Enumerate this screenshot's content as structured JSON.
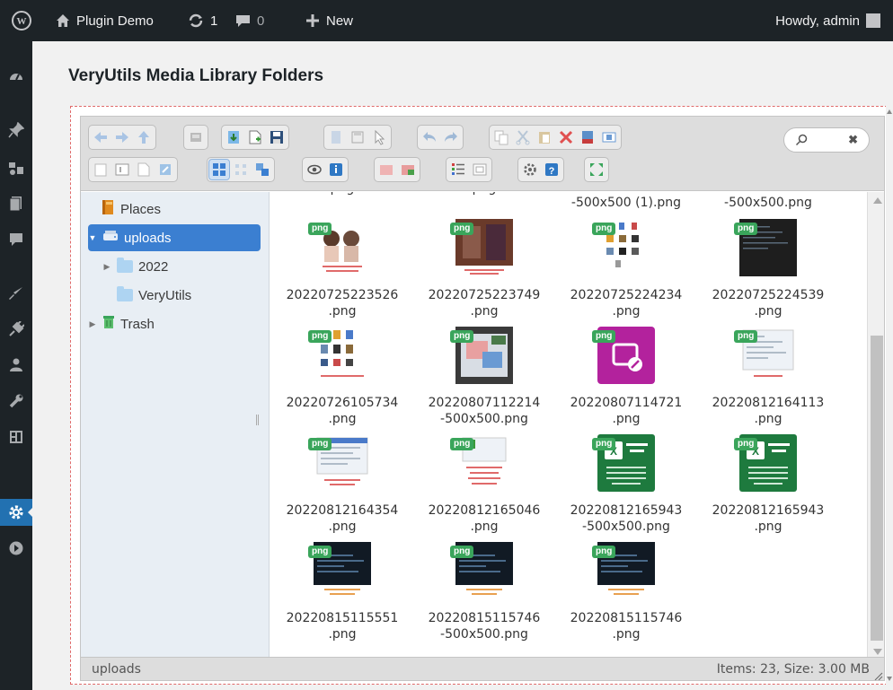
{
  "adminbar": {
    "site_name": "Plugin Demo",
    "updates_count": "1",
    "comments_count": "0",
    "new_label": "New",
    "howdy": "Howdy, admin"
  },
  "page": {
    "title": "VeryUtils Media Library Folders"
  },
  "tree": {
    "places": "Places",
    "uploads": "uploads",
    "folder_2022": "2022",
    "folder_veryutils": "VeryUtils",
    "trash": "Trash"
  },
  "search": {
    "clear_label": "✖"
  },
  "partial_row": [
    "-500x500 (1).png",
    "-500x500.png"
  ],
  "files": [
    {
      "line1": "20220725223526",
      "line2": ".png",
      "badge": "png"
    },
    {
      "line1": "20220725223749",
      "line2": ".png",
      "badge": "png"
    },
    {
      "line1": "20220725224234",
      "line2": ".png",
      "badge": "png"
    },
    {
      "line1": "20220725224539",
      "line2": ".png",
      "badge": "png"
    },
    {
      "line1": "20220726105734",
      "line2": ".png",
      "badge": "png"
    },
    {
      "line1": "20220807112214",
      "line2": "-500x500.png",
      "badge": "png"
    },
    {
      "line1": "20220807114721",
      "line2": ".png",
      "badge": "png"
    },
    {
      "line1": "20220812164113",
      "line2": ".png",
      "badge": "png"
    },
    {
      "line1": "20220812164354",
      "line2": ".png",
      "badge": "png"
    },
    {
      "line1": "20220812165046",
      "line2": ".png",
      "badge": "png"
    },
    {
      "line1": "20220812165943",
      "line2": "-500x500.png",
      "badge": "png"
    },
    {
      "line1": "20220812165943",
      "line2": ".png",
      "badge": "png"
    },
    {
      "line1": "20220815115551",
      "line2": ".png",
      "badge": "png"
    },
    {
      "line1": "20220815115746",
      "line2": "-500x500.png",
      "badge": "png"
    },
    {
      "line1": "20220815115746",
      "line2": ".png",
      "badge": "png"
    }
  ],
  "statusbar": {
    "path": "uploads",
    "info": "Items: 23, Size: 3.00 MB"
  },
  "colors": {
    "adminbar_bg": "#1d2327",
    "accent": "#2271b1",
    "selected_folder": "#3b7fd1",
    "badge_green": "#3aa55b",
    "frame_dash": "#e06a6a"
  }
}
